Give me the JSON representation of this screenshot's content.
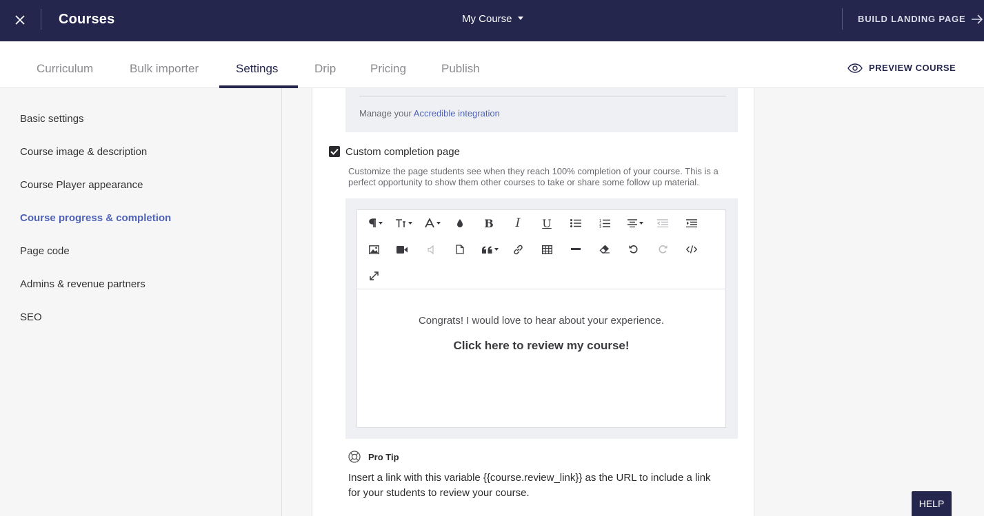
{
  "topbar": {
    "title": "Courses",
    "course_selector": "My Course",
    "build_landing": "BUILD LANDING PAGE"
  },
  "tabs": [
    {
      "label": "Curriculum"
    },
    {
      "label": "Bulk importer"
    },
    {
      "label": "Settings",
      "active": true
    },
    {
      "label": "Drip"
    },
    {
      "label": "Pricing"
    },
    {
      "label": "Publish"
    }
  ],
  "preview_label": "PREVIEW COURSE",
  "sidebar": {
    "items": [
      {
        "label": "Basic settings"
      },
      {
        "label": "Course image & description"
      },
      {
        "label": "Course Player appearance"
      },
      {
        "label": "Course progress & completion",
        "active": true
      },
      {
        "label": "Page code"
      },
      {
        "label": "Admins & revenue partners"
      },
      {
        "label": "SEO"
      }
    ]
  },
  "accredible": {
    "prefix": "Manage your ",
    "link": "Accredible integration"
  },
  "completion": {
    "checkbox_label": "Custom completion page",
    "checked": true,
    "description": "Customize the page students see when they reach 100% completion of your course. This is a perfect opportunity to show them other courses to take or share some follow up material."
  },
  "editor": {
    "line1": "Congrats! I would love to hear about your experience.",
    "line2": "Click here to review my course!"
  },
  "protip": {
    "label": "Pro Tip",
    "text": "Insert a link with this variable {{course.review_link}} as the URL to include a link for your students to review your course."
  },
  "help_label": "HELP",
  "colors": {
    "topbar": "#25264e",
    "accent": "#4f62b8",
    "background": "#f6f6f7"
  }
}
